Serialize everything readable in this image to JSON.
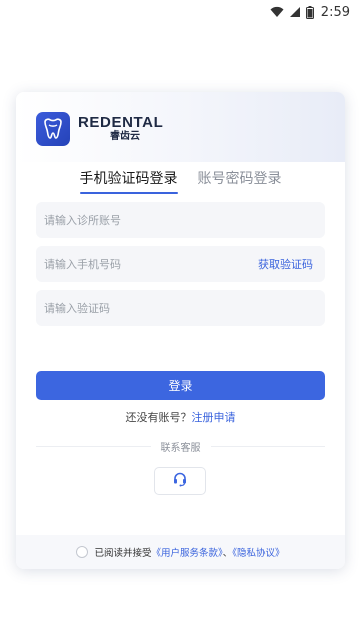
{
  "status_bar": {
    "time": "2:59"
  },
  "brand": {
    "name_en": "REDENTAL",
    "name_cn": "睿齿云"
  },
  "tabs": [
    {
      "label": "手机验证码登录",
      "active": true
    },
    {
      "label": "账号密码登录",
      "active": false
    }
  ],
  "form": {
    "clinic_account_placeholder": "请输入诊所账号",
    "phone_placeholder": "请输入手机号码",
    "get_code_label": "获取验证码",
    "code_placeholder": "请输入验证码"
  },
  "login_button": "登录",
  "register": {
    "prompt": "还没有账号？",
    "link": "注册申请"
  },
  "customer_service": {
    "label": "联系客服",
    "icon": "headset-icon"
  },
  "agreement": {
    "prefix": "已阅读并接受",
    "terms": "《用户服务条款》",
    "separator": "、",
    "privacy": "《隐私协议》"
  },
  "colors": {
    "accent": "#3c66e0",
    "brand": "#2f4fcf"
  }
}
